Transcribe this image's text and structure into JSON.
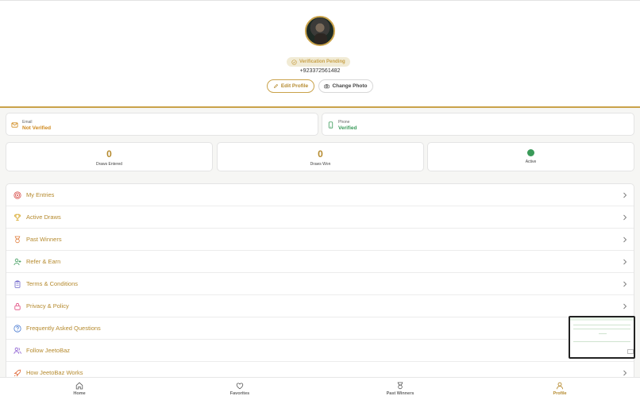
{
  "profile": {
    "verification_status": "Verification Pending",
    "phone_number": "+923372561482",
    "edit_profile_label": "Edit Profile",
    "change_photo_label": "Change Photo"
  },
  "contact": {
    "email": {
      "label": "Email",
      "status": "Not Verified"
    },
    "phone": {
      "label": "Phone",
      "status": "Verified"
    }
  },
  "stats": [
    {
      "value": "0",
      "label": "Draws Entered"
    },
    {
      "value": "0",
      "label": "Draws Won"
    },
    {
      "label": "Active",
      "indicator_color": "#3a9a59"
    }
  ],
  "menu": [
    {
      "label": "My Entries",
      "icon": "target-icon"
    },
    {
      "label": "Active Draws",
      "icon": "trophy-icon"
    },
    {
      "label": "Past Winners",
      "icon": "award-icon"
    },
    {
      "label": "Refer & Earn",
      "icon": "user-plus-icon"
    },
    {
      "label": "Terms & Conditions",
      "icon": "clipboard-icon"
    },
    {
      "label": "Privacy & Policy",
      "icon": "lock-icon"
    },
    {
      "label": "Frequently Asked Questions",
      "icon": "help-circle-icon"
    },
    {
      "label": "Follow JeetoBaz",
      "icon": "users-icon"
    },
    {
      "label": "How JeetoBaz Works",
      "icon": "rocket-icon"
    }
  ],
  "tabs": [
    {
      "label": "Home",
      "icon": "home-icon",
      "active": false
    },
    {
      "label": "Favorites",
      "icon": "heart-icon",
      "active": false
    },
    {
      "label": "Past Winners",
      "icon": "award-icon",
      "active": false
    },
    {
      "label": "Profile",
      "icon": "user-icon",
      "active": true
    }
  ],
  "colors": {
    "accent": "#b58a2e",
    "gold_border": "#c9a24a",
    "success": "#3a9a59",
    "warning": "#d08a1e"
  }
}
